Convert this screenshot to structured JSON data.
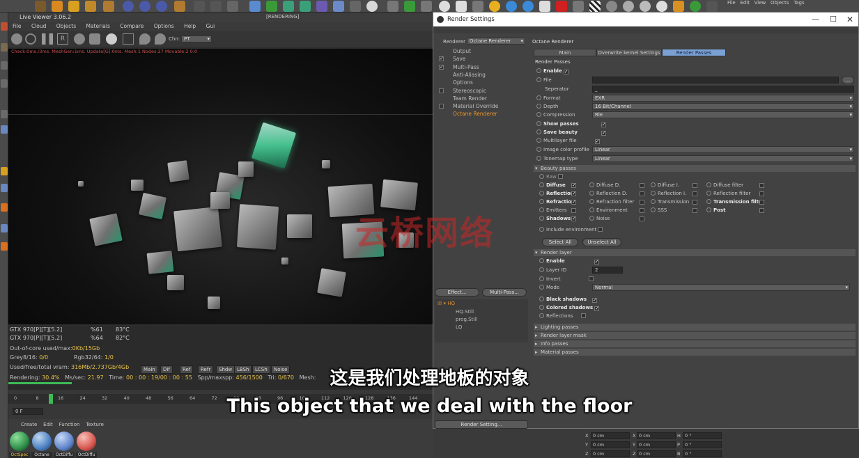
{
  "top_right_menu": [
    "File",
    "Edit",
    "View",
    "Objects",
    "Tags"
  ],
  "live_viewer": {
    "title": "Live Viewer 3.06.2",
    "menu": [
      "File",
      "Cloud",
      "Objects",
      "Materials",
      "Compare",
      "Options",
      "Help",
      "Gui"
    ],
    "state": "[RENDERING]",
    "chn_label": "Chn:",
    "chn_value": "PT",
    "check_line": "Check:0ms./3ms. MeshGen:1ms. Update[G]:0ms. Mesh:1 Nodes:27 Movable:2  0:0",
    "gpus": [
      {
        "name": "GTX 970[P][T][5.2]",
        "usage": "%61",
        "temp": "83°C"
      },
      {
        "name": "GTX 970[P][T][5.2]",
        "usage": "%64",
        "temp": "82°C"
      }
    ],
    "out_of_core_label": "Out-of-core used/max:",
    "out_of_core_value": "0Kb/15Gb",
    "grey_label": "Grey8/16:",
    "grey_value": "0/0",
    "rgb_label": "Rgb32/64:",
    "rgb_value": "1/0",
    "vram_label": "Used/free/total vram:",
    "vram_value": "316Mb/2.737Gb/4Gb",
    "pass_tabs": [
      "Main",
      "Dif",
      "Ref",
      "Refr",
      "Shdw",
      "LBSh",
      "LCSh",
      "Noise"
    ],
    "rendering_label": "Rendering:",
    "rendering_value": "30.4%",
    "ms_label": "Ms/sec:",
    "ms_value": "21.97",
    "time_label": "Time:",
    "time_value": "00 : 00 : 19/00 : 00 : 55",
    "spp_label": "Spp/maxspp:",
    "spp_value": "456/1500",
    "tri_label": "Tri:",
    "tri_value": "0/670",
    "mesh_label": "Mesh:",
    "progress": 0.304
  },
  "timeline": {
    "ticks": [
      "0",
      "8",
      "16",
      "24",
      "32",
      "40",
      "48",
      "56",
      "64",
      "72",
      "80",
      "88",
      "96",
      "104",
      "112",
      "120",
      "128",
      "136",
      "144"
    ],
    "frame_field": "0 F",
    "current_frame": "16"
  },
  "material_manager": {
    "menu": [
      "Create",
      "Edit",
      "Function",
      "Texture"
    ],
    "materials": [
      {
        "name": "OctSpec",
        "color": "#2e8f4a"
      },
      {
        "name": "Octane",
        "color": "#4b7fc2"
      },
      {
        "name": "OctDiffu",
        "color": "#5e84c9"
      },
      {
        "name": "OctDiffu",
        "color": "#d8574f"
      }
    ]
  },
  "coords": {
    "rows": [
      {
        "a": "X",
        "av": "0 cm",
        "b": "X",
        "bv": "0 cm",
        "c": "H",
        "cv": "0 °"
      },
      {
        "a": "Y",
        "av": "0 cm",
        "b": "Y",
        "bv": "0 cm",
        "c": "P",
        "cv": "0 °"
      },
      {
        "a": "Z",
        "av": "0 cm",
        "b": "Z",
        "bv": "0 cm",
        "c": "B",
        "cv": "0 °"
      }
    ]
  },
  "render_settings": {
    "title": "Render Settings",
    "renderer_label": "Renderer",
    "renderer_value": "Octane Renderer",
    "tree": [
      {
        "label": "Output",
        "checked": null,
        "active": false
      },
      {
        "label": "Save",
        "checked": true,
        "active": false
      },
      {
        "label": "Multi-Pass",
        "checked": true,
        "active": false
      },
      {
        "label": "Anti-Aliasing",
        "checked": null,
        "active": false
      },
      {
        "label": "Options",
        "checked": null,
        "active": false
      },
      {
        "label": "Stereoscopic",
        "checked": false,
        "active": false
      },
      {
        "label": "Team Render",
        "checked": null,
        "active": false
      },
      {
        "label": "Material Override",
        "checked": false,
        "active": false
      },
      {
        "label": "Octane Renderer",
        "checked": null,
        "active": true
      }
    ],
    "effect_button": "Effect...",
    "multipass_button": "Multi-Pass...",
    "presets": [
      "HQ",
      "HQ.Still",
      "prog.Still",
      "LQ"
    ],
    "render_setting_button": "Render Setting...",
    "panel_title": "Octane Renderer",
    "tabs": [
      "Main",
      "Overwrite kernel Settings",
      "Render Passes"
    ],
    "active_tab": "Render Passes",
    "section_render_passes": "Render Passes",
    "enable_label": "Enable",
    "file_label": "File",
    "file_button": "...",
    "separator_label": "Seperator",
    "separator_value": "_",
    "format_label": "Format",
    "format_value": "EXR",
    "depth_label": "Depth",
    "depth_value": "16 Bit/Channel",
    "compression_label": "Compression",
    "compression_value": "Rle",
    "show_passes_label": "Show passes",
    "save_beauty_label": "Save beauty",
    "multilayer_label": "Multilayer file",
    "image_color_label": "Image color profile",
    "image_color_value": "Linear",
    "tonemap_label": "Tonemap type",
    "tonemap_value": "Linear",
    "section_beauty": "Beauty passes",
    "raw_label": "Raw",
    "beauty_grid": [
      [
        {
          "l": "Diffuse",
          "b": true,
          "c": true
        },
        {
          "l": "Diffuse D.",
          "b": false,
          "c": false
        },
        {
          "l": "Diffuse I.",
          "b": false,
          "c": false
        },
        {
          "l": "Diffuse filter",
          "b": false,
          "c": false
        }
      ],
      [
        {
          "l": "Reflection",
          "b": true,
          "c": true
        },
        {
          "l": "Reflection D.",
          "b": false,
          "c": false
        },
        {
          "l": "Reflection I.",
          "b": false,
          "c": false
        },
        {
          "l": "Reflection filter",
          "b": false,
          "c": false
        }
      ],
      [
        {
          "l": "Refraction",
          "b": true,
          "c": true
        },
        {
          "l": "Refraction filter",
          "b": false,
          "c": false
        },
        {
          "l": "Transmission",
          "b": false,
          "c": false
        },
        {
          "l": "Transmission filter",
          "b": true,
          "c": false
        }
      ],
      [
        {
          "l": "Emitters",
          "b": false,
          "c": false
        },
        {
          "l": "Environment",
          "b": false,
          "c": false
        },
        {
          "l": "SSS",
          "b": false,
          "c": false
        },
        {
          "l": "Post",
          "b": true,
          "c": false
        }
      ],
      [
        {
          "l": "Shadows",
          "b": true,
          "c": true
        },
        {
          "l": "Noise",
          "b": false,
          "c": false
        }
      ]
    ],
    "include_env_label": "Include environment",
    "select_all": "Select All",
    "unselect_all": "Unselect All",
    "section_render_layer": "Render layer",
    "rl_enable": "Enable",
    "layer_id_label": "Layer ID",
    "layer_id_value": "2",
    "invert_label": "Invert",
    "mode_label": "Mode",
    "mode_value": "Normal",
    "black_shadows": "Black shadows",
    "colored_shadows": "Colored shadows",
    "reflections": "Reflections",
    "closed_sections": [
      "Lighting passes",
      "Render layer mask",
      "Info passes",
      "Material passes"
    ]
  },
  "watermark": "云桥网络",
  "subtitle_cn": "这是我们处理地板的对象",
  "subtitle_en": "This object that we deal with the floor"
}
